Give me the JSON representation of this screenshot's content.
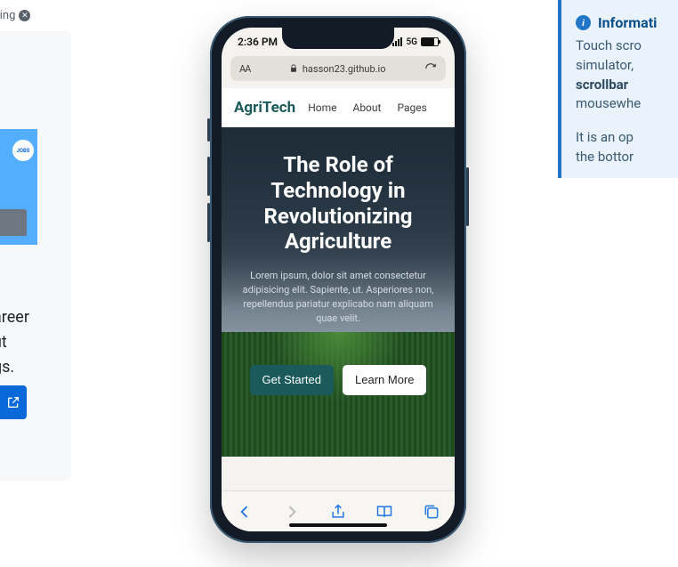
{
  "left": {
    "ad_label": "Advertising",
    "jobs_badge": "JOBS",
    "career_lines": [
      "areer",
      "ut",
      "gs."
    ]
  },
  "info": {
    "title": "Informati",
    "line1": "Touch scro",
    "line2": "simulator,",
    "line3_strong": "scrollbar",
    "line4": "mousewhe",
    "line5": "It is an op",
    "line6": "the bottor"
  },
  "phone": {
    "time": "2:36 PM",
    "signal_label": "5G",
    "addr_aa": "AA",
    "addr_host": "hasson23.github.io"
  },
  "site": {
    "brand": "AgriTech",
    "nav": {
      "home": "Home",
      "about": "About",
      "pages": "Pages"
    },
    "hero_title": "The Role of Technology in Revolutionizing Agriculture",
    "hero_body": "Lorem ipsum, dolor sit amet consectetur adipisicing elit. Sapiente, ut. Asperiores non, repellendus pariatur explicabo nam aliquam quae velit.",
    "btn_primary": "Get Started",
    "btn_secondary": "Learn More"
  }
}
